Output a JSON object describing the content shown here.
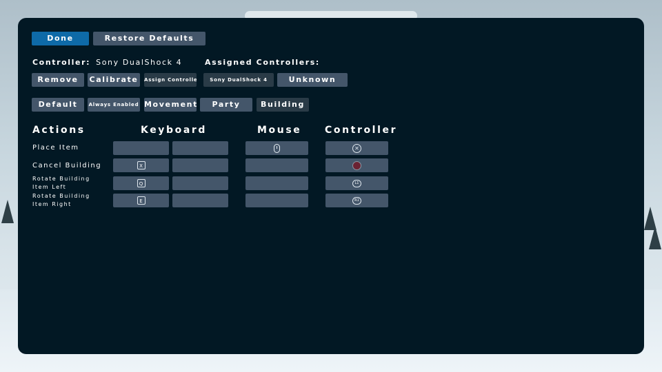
{
  "toolbar": {
    "done_label": "Done",
    "restore_label": "Restore Defaults"
  },
  "controller": {
    "label": "Controller:",
    "name": "Sony DualShock 4",
    "assigned_label": "Assigned Controllers:",
    "actions": [
      "Remove",
      "Calibrate",
      "Assign Controller"
    ],
    "assigned": [
      "Sony DualShock 4",
      "Unknown"
    ]
  },
  "categories": [
    "Default",
    "Always Enabled",
    "Movement",
    "Party",
    "Building"
  ],
  "columns": {
    "actions": "Actions",
    "keyboard": "Keyboard",
    "mouse": "Mouse",
    "controller": "Controller"
  },
  "bindings": [
    {
      "action": "Place Item",
      "key1": "",
      "key2": "",
      "mouse": "mouse-left-click-icon",
      "pad": "cross-button-icon"
    },
    {
      "action": "Cancel Building",
      "key1": "X",
      "key2": "",
      "mouse": "",
      "pad": "circle-button-icon"
    },
    {
      "action": "Rotate Building Item Left",
      "key1": "Q",
      "key2": "",
      "mouse": "",
      "pad": "L1"
    },
    {
      "action": "Rotate Building Item Right",
      "key1": "E",
      "key2": "",
      "mouse": "",
      "pad": "R1"
    }
  ],
  "colors": {
    "panel": "#021824",
    "button": "#44566a",
    "primary": "#0e6aa8",
    "text": "#ffffff"
  }
}
